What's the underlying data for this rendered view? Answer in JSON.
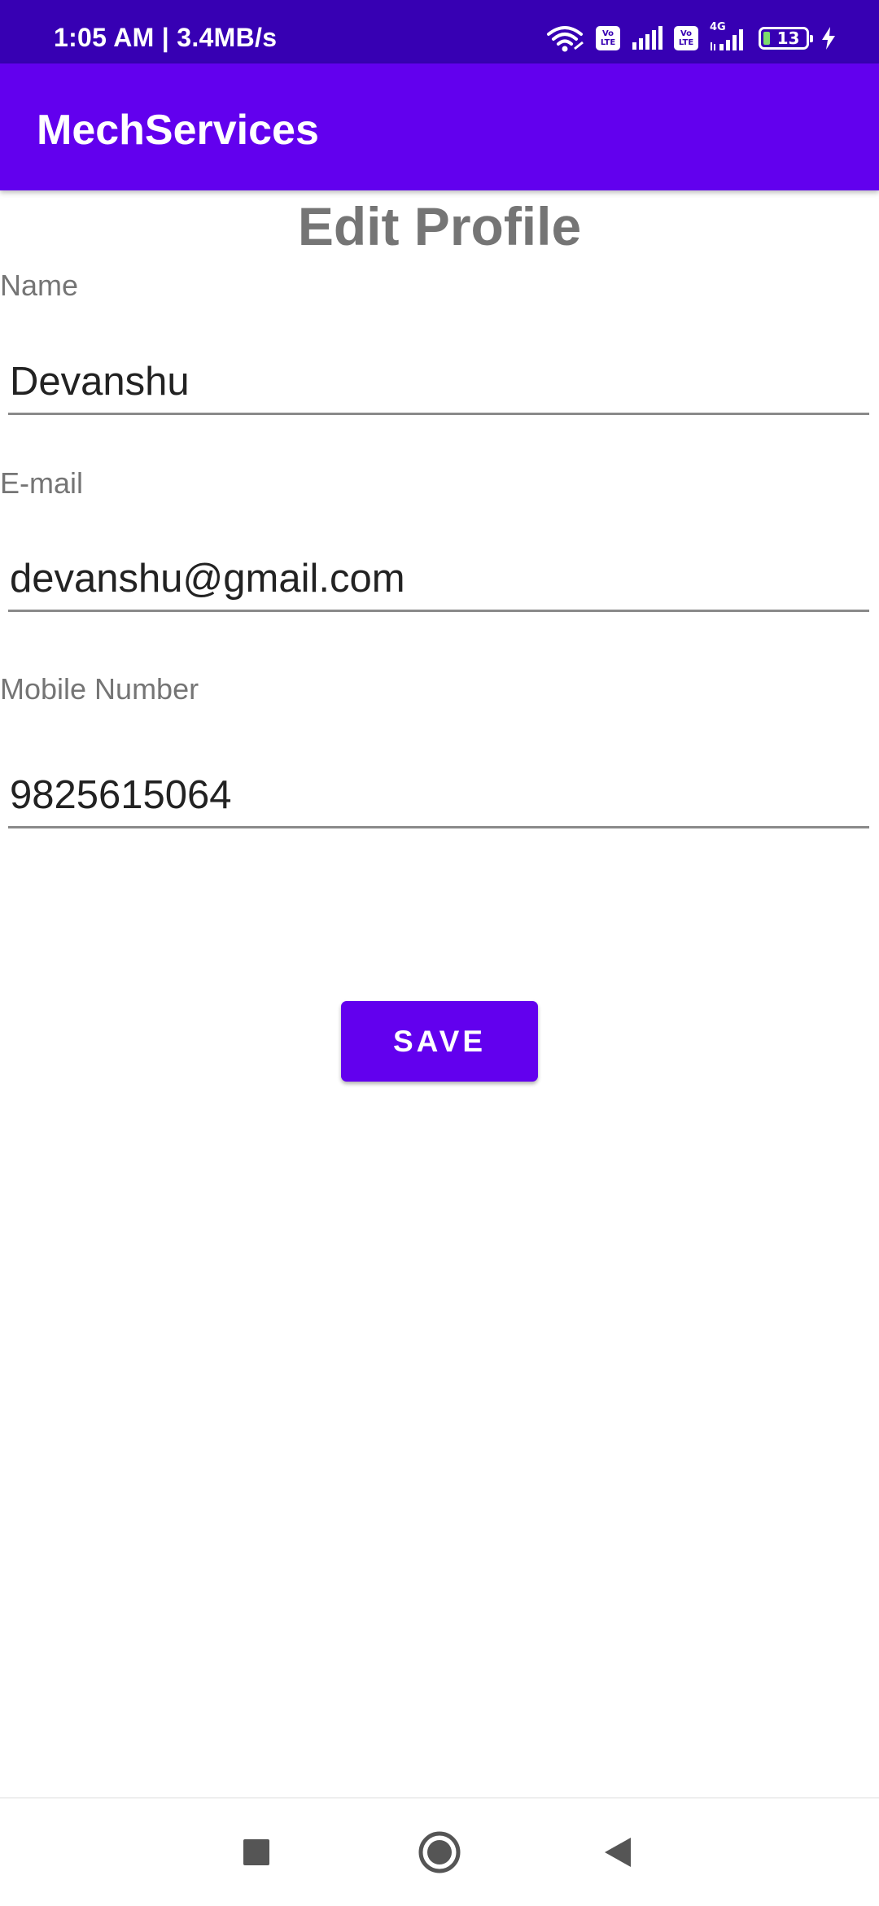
{
  "status_bar": {
    "time": "1:05 AM | 3.4MB/s",
    "sim1_badge": [
      "Vo",
      "LTE"
    ],
    "sim2_badge": [
      "Vo",
      "LTE"
    ],
    "network_type": "4G",
    "battery_level": "13",
    "icons": [
      "wifi-icon",
      "signal-icon",
      "signal-icon",
      "battery-icon",
      "charging-icon"
    ]
  },
  "app_bar": {
    "title": "MechServices"
  },
  "page": {
    "title": "Edit Profile"
  },
  "form": {
    "name_label": "Name",
    "name_value": "Devanshu",
    "email_label": "E-mail",
    "email_value": "devanshu@gmail.com",
    "mobile_label": "Mobile Number",
    "mobile_value": "9825615064",
    "save_label": "SAVE"
  },
  "nav_bar": {
    "icons": [
      "recent-apps-icon",
      "home-icon",
      "back-icon"
    ]
  },
  "colors": {
    "status_bar": "#3700b3",
    "app_bar": "#6200ee",
    "button": "#6200ee",
    "label_text": "#757575"
  }
}
